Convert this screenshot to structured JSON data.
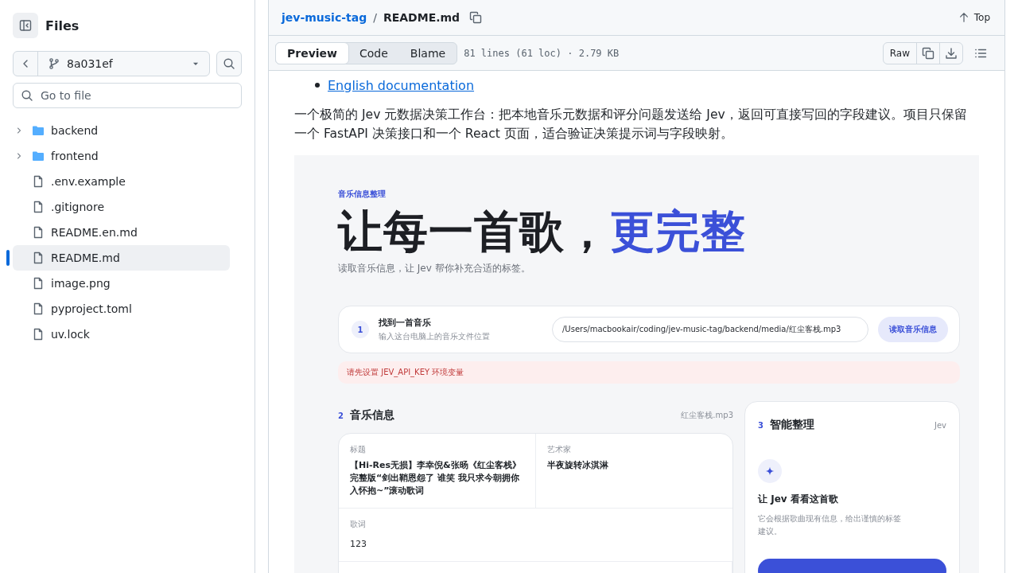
{
  "sidebar": {
    "title": "Files",
    "branch": "8a031ef",
    "search": {
      "placeholder": "Go to file"
    },
    "tree": [
      {
        "name": "backend",
        "kind": "folder",
        "expanded": false,
        "selected": false
      },
      {
        "name": "frontend",
        "kind": "folder",
        "expanded": false,
        "selected": false
      },
      {
        "name": ".env.example",
        "kind": "file",
        "selected": false
      },
      {
        "name": ".gitignore",
        "kind": "file",
        "selected": false
      },
      {
        "name": "README.en.md",
        "kind": "file",
        "selected": false
      },
      {
        "name": "README.md",
        "kind": "file",
        "selected": true
      },
      {
        "name": "image.png",
        "kind": "file",
        "selected": false
      },
      {
        "name": "pyproject.toml",
        "kind": "file",
        "selected": false
      },
      {
        "name": "uv.lock",
        "kind": "file",
        "selected": false
      }
    ]
  },
  "header": {
    "repo": "jev-music-tag",
    "separator": "/",
    "file": "README.md",
    "top": "Top"
  },
  "toolbar": {
    "tabs": [
      {
        "label": "Preview",
        "selected": true
      },
      {
        "label": "Code",
        "selected": false
      },
      {
        "label": "Blame",
        "selected": false
      }
    ],
    "info": "81 lines (61 loc) · 2.79 KB",
    "raw": "Raw"
  },
  "readme": {
    "links": [
      "English documentation"
    ],
    "paragraph": "一个极简的 Jev 元数据决策工作台：把本地音乐元数据和评分问题发送给 Jev，返回可直接写回的字段建议。项目只保留一个 FastAPI 决策接口和一个 React 页面，适合验证决策提示词与字段映射。",
    "screenshot": {
      "eyebrow": "音乐信息整理",
      "headline": "让每一首歌，",
      "headline_accent": "更完整",
      "subtitle": "读取音乐信息，让 Jev 帮你补充合适的标签。",
      "step": {
        "number": "1",
        "title": "找到一首音乐",
        "hint": "输入这台电脑上的音乐文件位置",
        "path": "/Users/macbookair/coding/jev-music-tag/backend/media/红尘客栈.mp3",
        "button": "读取音乐信息"
      },
      "error": "请先设置 JEV_API_KEY 环境变量",
      "info": {
        "number": "2",
        "title": "音乐信息",
        "file": "红尘客栈.mp3",
        "fields": [
          {
            "label": "标题",
            "value": "【Hi-Res无损】李幸倪&张旸《红尘客栈》完整版“剑出鞘恩怨了 谁笑 我只求今朝拥你入怀抱~”滚动歌词",
            "wide": false
          },
          {
            "label": "艺术家",
            "value": "半夜旋转冰淇淋",
            "wide": false
          },
          {
            "label": "歌词",
            "value": "123",
            "wide": true
          }
        ]
      },
      "assistant": {
        "number": "3",
        "title": "智能整理",
        "badge": "Jev",
        "heading": "让 Jev 看看这首歌",
        "text": "它会根据歌曲现有信息，给出谨慎的标签建议。"
      }
    }
  }
}
